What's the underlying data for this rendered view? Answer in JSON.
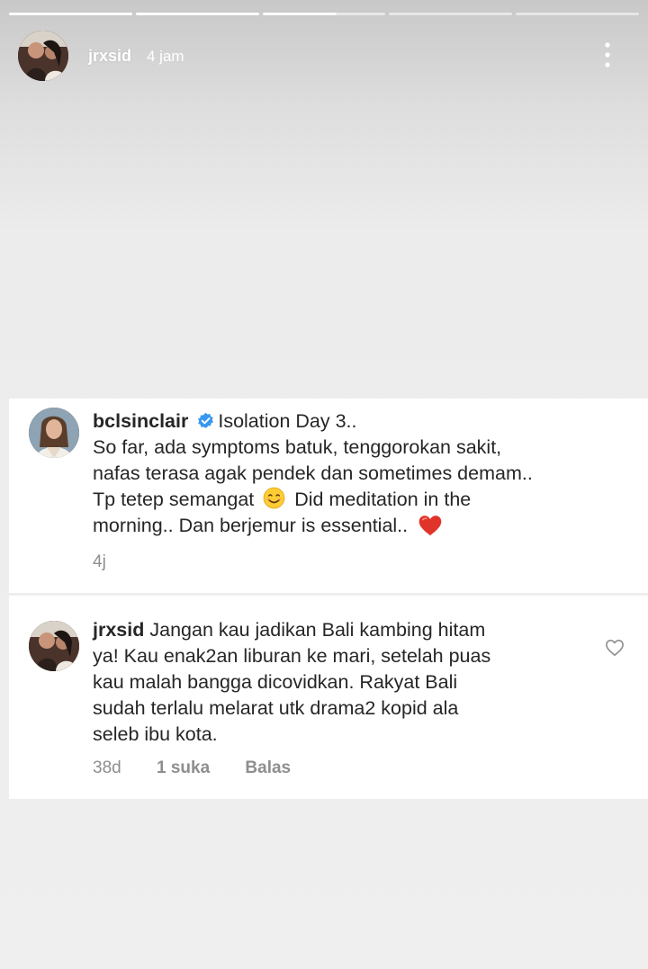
{
  "story": {
    "progress_segments": 5,
    "active_segment_fraction": 0.6,
    "username": "jrxsid",
    "time": "4 jam"
  },
  "post": {
    "username": "bclsinclair",
    "verified": true,
    "first_line": "Isolation Day 3..",
    "lines": [
      "So far, ada symptoms batuk, tenggorokan sakit,",
      "nafas terasa agak pendek dan sometimes demam..",
      "Tp tetep semangat",
      "Did meditation in the",
      "morning.. Dan berjemur is essential.."
    ],
    "age": "4j"
  },
  "reply": {
    "username": "jrxsid",
    "lines": [
      "Jangan kau jadikan Bali kambing hitam",
      "ya! Kau enak2an liburan ke mari, setelah puas",
      "kau malah bangga dicovidkan. Rakyat Bali",
      "sudah terlalu melarat utk drama2 kopid ala",
      "seleb ibu kota."
    ],
    "age": "38d",
    "likes": "1 suka",
    "reply_label": "Balas"
  },
  "icons": {
    "verified": "verified-badge-icon",
    "smile": "smiling-face-emoji",
    "heart_emoji": "red-heart-emoji",
    "like": "heart-outline-icon",
    "more": "more-vertical-icon"
  },
  "colors": {
    "verified_blue": "#3897f0",
    "heart_red": "#e0332a",
    "meta_gray": "#8e8e8e"
  }
}
